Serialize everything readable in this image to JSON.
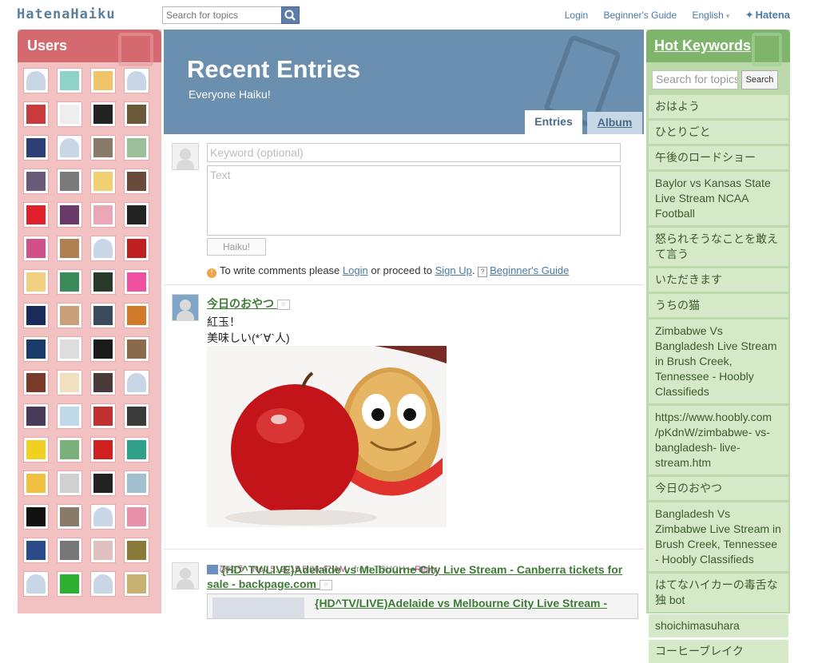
{
  "header": {
    "logo": "HatenaHaiku",
    "search_placeholder": "Search for topics",
    "nav": {
      "login": "Login",
      "guide": "Beginner's Guide",
      "lang": "English",
      "hatena": "Hatena"
    }
  },
  "users": {
    "title": "Users",
    "avatars": [
      "blank",
      "face-green",
      "face-cat",
      "blank",
      "redhair-girl",
      "white-bunny",
      "butterfly",
      "old-man",
      "man-suit",
      "blank",
      "cat-photo",
      "figures",
      "robot",
      "elephant",
      "chicken",
      "room",
      "red-heart",
      "purple-girl",
      "pink-girl",
      "black-hat",
      "pink-flower",
      "brown-hair",
      "blank",
      "ken-logo",
      "blonde-anime",
      "green-frog",
      "dark-badge",
      "pink-daisy",
      "trident",
      "girl-face",
      "dark-photo",
      "orange-fox",
      "blue-flower",
      "white-cat",
      "pixel-sun",
      "dog-photo",
      "drink",
      "cream-cat",
      "dark-room",
      "blank",
      "sunset",
      "white-blob",
      "robot-2",
      "dark-anime",
      "y-letter",
      "green-girl",
      "mushroom",
      "hyphy",
      "fox-girl",
      "white-dog",
      "kanji-stamp",
      "white-frog",
      "bird-black",
      "dog-outline",
      "blank",
      "pink-pig",
      "ab-letters",
      "face-mask",
      "doll",
      "cyber-face",
      "blank",
      "leaf-green",
      "blank",
      "tan-face"
    ]
  },
  "main": {
    "title": "Recent Entries",
    "subtitle": "Everyone Haiku!",
    "tabs": {
      "entries": "Entries",
      "album": "Album"
    },
    "compose": {
      "keyword_placeholder": "Keyword (optional)",
      "text_placeholder": "Text",
      "submit": "Haiku!"
    },
    "notice": {
      "pre": "To write comments please",
      "login": "Login",
      "mid": "or proceed to",
      "signup": "Sign Up",
      "guide": "Beginner's Guide"
    },
    "entries": [
      {
        "keyword": "今日のおやつ",
        "lines": [
          "紅玉！",
          "美味しい(*´∀`人)"
        ],
        "meta_by": "by",
        "user": "ひゆう",
        "time": "Nov 5, 2015 5:06:47 AM",
        "from": "from TOUCH",
        "reply": "Reply"
      },
      {
        "keyword": "{HD^TV/LIVE)Adelaide vs Melbourne City Live Stream - Canberra tickets for sale - backpage.com",
        "sub_title": "{HD^TV/LIVE)Adelaide vs Melbourne City Live Stream -"
      }
    ]
  },
  "keywords": {
    "title": "Hot Keywords",
    "search_placeholder": "Search for topics",
    "search_button": "Search",
    "items": [
      "おはよう",
      "ひとりごと",
      "午後のロードショー",
      "Baylor vs Kansas State Live Stream NCAA Football",
      "怒られそうなことを敢えて言う",
      "いただきます",
      "うちの猫",
      "Zimbabwe Vs Bangladesh Live Stream in Brush Creek, Tennessee - Hoobly Classifieds",
      "https://www.hoobly.com /pKdnW/zimbabwe- vs-bangladesh- live-stream.htm",
      "今日のおやつ",
      "Bangladesh Vs Zimbabwe Live Stream in Brush Creek, Tennessee - Hoobly Classifieds",
      "はてなハイカーの毒舌な独 bot",
      "shoichimasuhara",
      "コーヒーブレイク"
    ]
  },
  "colors": {
    "users_bg": "#f2c1c1",
    "users_head": "#d46a6f",
    "banner": "#6b8fae",
    "keywords_bg": "#bcd9ab",
    "keywords_head": "#7eb56b",
    "link": "#4b79a8"
  }
}
